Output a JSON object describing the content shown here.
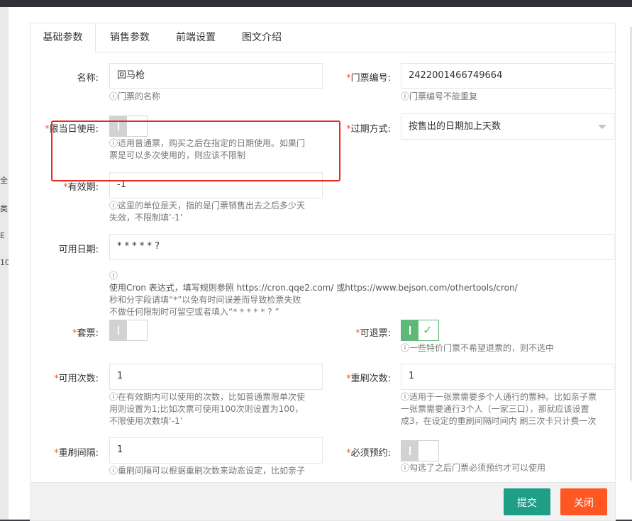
{
  "tabs": [
    {
      "label": "基础参数",
      "active": true
    },
    {
      "label": "销售参数",
      "active": false
    },
    {
      "label": "前端设置",
      "active": false
    },
    {
      "label": "图文介绍",
      "active": false
    }
  ],
  "hint_prefix": "ⓘ",
  "fields": {
    "name": {
      "label": "名称:",
      "value": "回马枪",
      "hint": "门票的名称"
    },
    "ticket_no": {
      "label": "门票编号:",
      "value": "2422001466749664",
      "hint": "门票编号不能重复"
    },
    "same_day": {
      "label": "限当日使用:",
      "hint_line1": "适用普通票，购买之后在指定的日期使用。如果门",
      "hint_line2": "票是可以多次使用的，则应该不限制",
      "checked": false
    },
    "expire_mode": {
      "label": "过期方式:",
      "value": "按售出的日期加上天数"
    },
    "validity": {
      "label": "有效期:",
      "value": "-1",
      "hint_line1": "这里的单位是天，指的是门票销售出去之后多少天",
      "hint_line2": "失效，不限制填‘-1’"
    },
    "available_date": {
      "label": "可用日期:",
      "value": "* * * * * ?",
      "hint_line1": "ⓘ",
      "hint_line2": "使用Cron 表达式，填写规则参照 https://cron.qqe2.com/ 或https://www.bejson.com/othertools/cron/",
      "hint_line3": "秒和分字段请填“*”以免有时间误差而导致检票失败",
      "hint_line4": "不做任何限制时可留空或者填入“* * * * * ? ”"
    },
    "package": {
      "label": "套票:",
      "checked": false
    },
    "refundable": {
      "label": "可退票:",
      "checked": true,
      "hint": "一些特价门票不希望退票的，则不选中"
    },
    "usage_count": {
      "label": "可用次数:",
      "value": "1",
      "hint_line1": "在有效期内可以使用的次数，比如普通票限单次使",
      "hint_line2": "用则设置为1;比如次票可使用100次则设置为100，",
      "hint_line3": "不限使用次数填‘-1’"
    },
    "reswipe_count": {
      "label": "重刷次数:",
      "value": "1",
      "hint_line1": "适用于一张票需要多个人通行的票种。比如亲子票",
      "hint_line2": "一张票需要通行3个人（一家三口），那就应该设置",
      "hint_line3": "成3，在设定的重刷间隔时间内 刷三次卡只计费一次"
    },
    "reswipe_interval": {
      "label": "重刷间隔:",
      "value": "1",
      "hint": "重刷间隔可以根据重刷次数来动态设定，比如亲子"
    },
    "reservation": {
      "label": "必须预约:",
      "checked": false,
      "hint": "勾选了之后门票必须预约才可以使用"
    }
  },
  "buttons": {
    "submit": "提交",
    "close": "关闭"
  },
  "left_strip_chars": [
    "全",
    "类",
    "E",
    "10"
  ],
  "colors": {
    "accent_green": "#5fb878",
    "submit": "#1e9e87",
    "close": "#ff5722",
    "required": "#ff5722",
    "highlight": "#e8291c"
  }
}
